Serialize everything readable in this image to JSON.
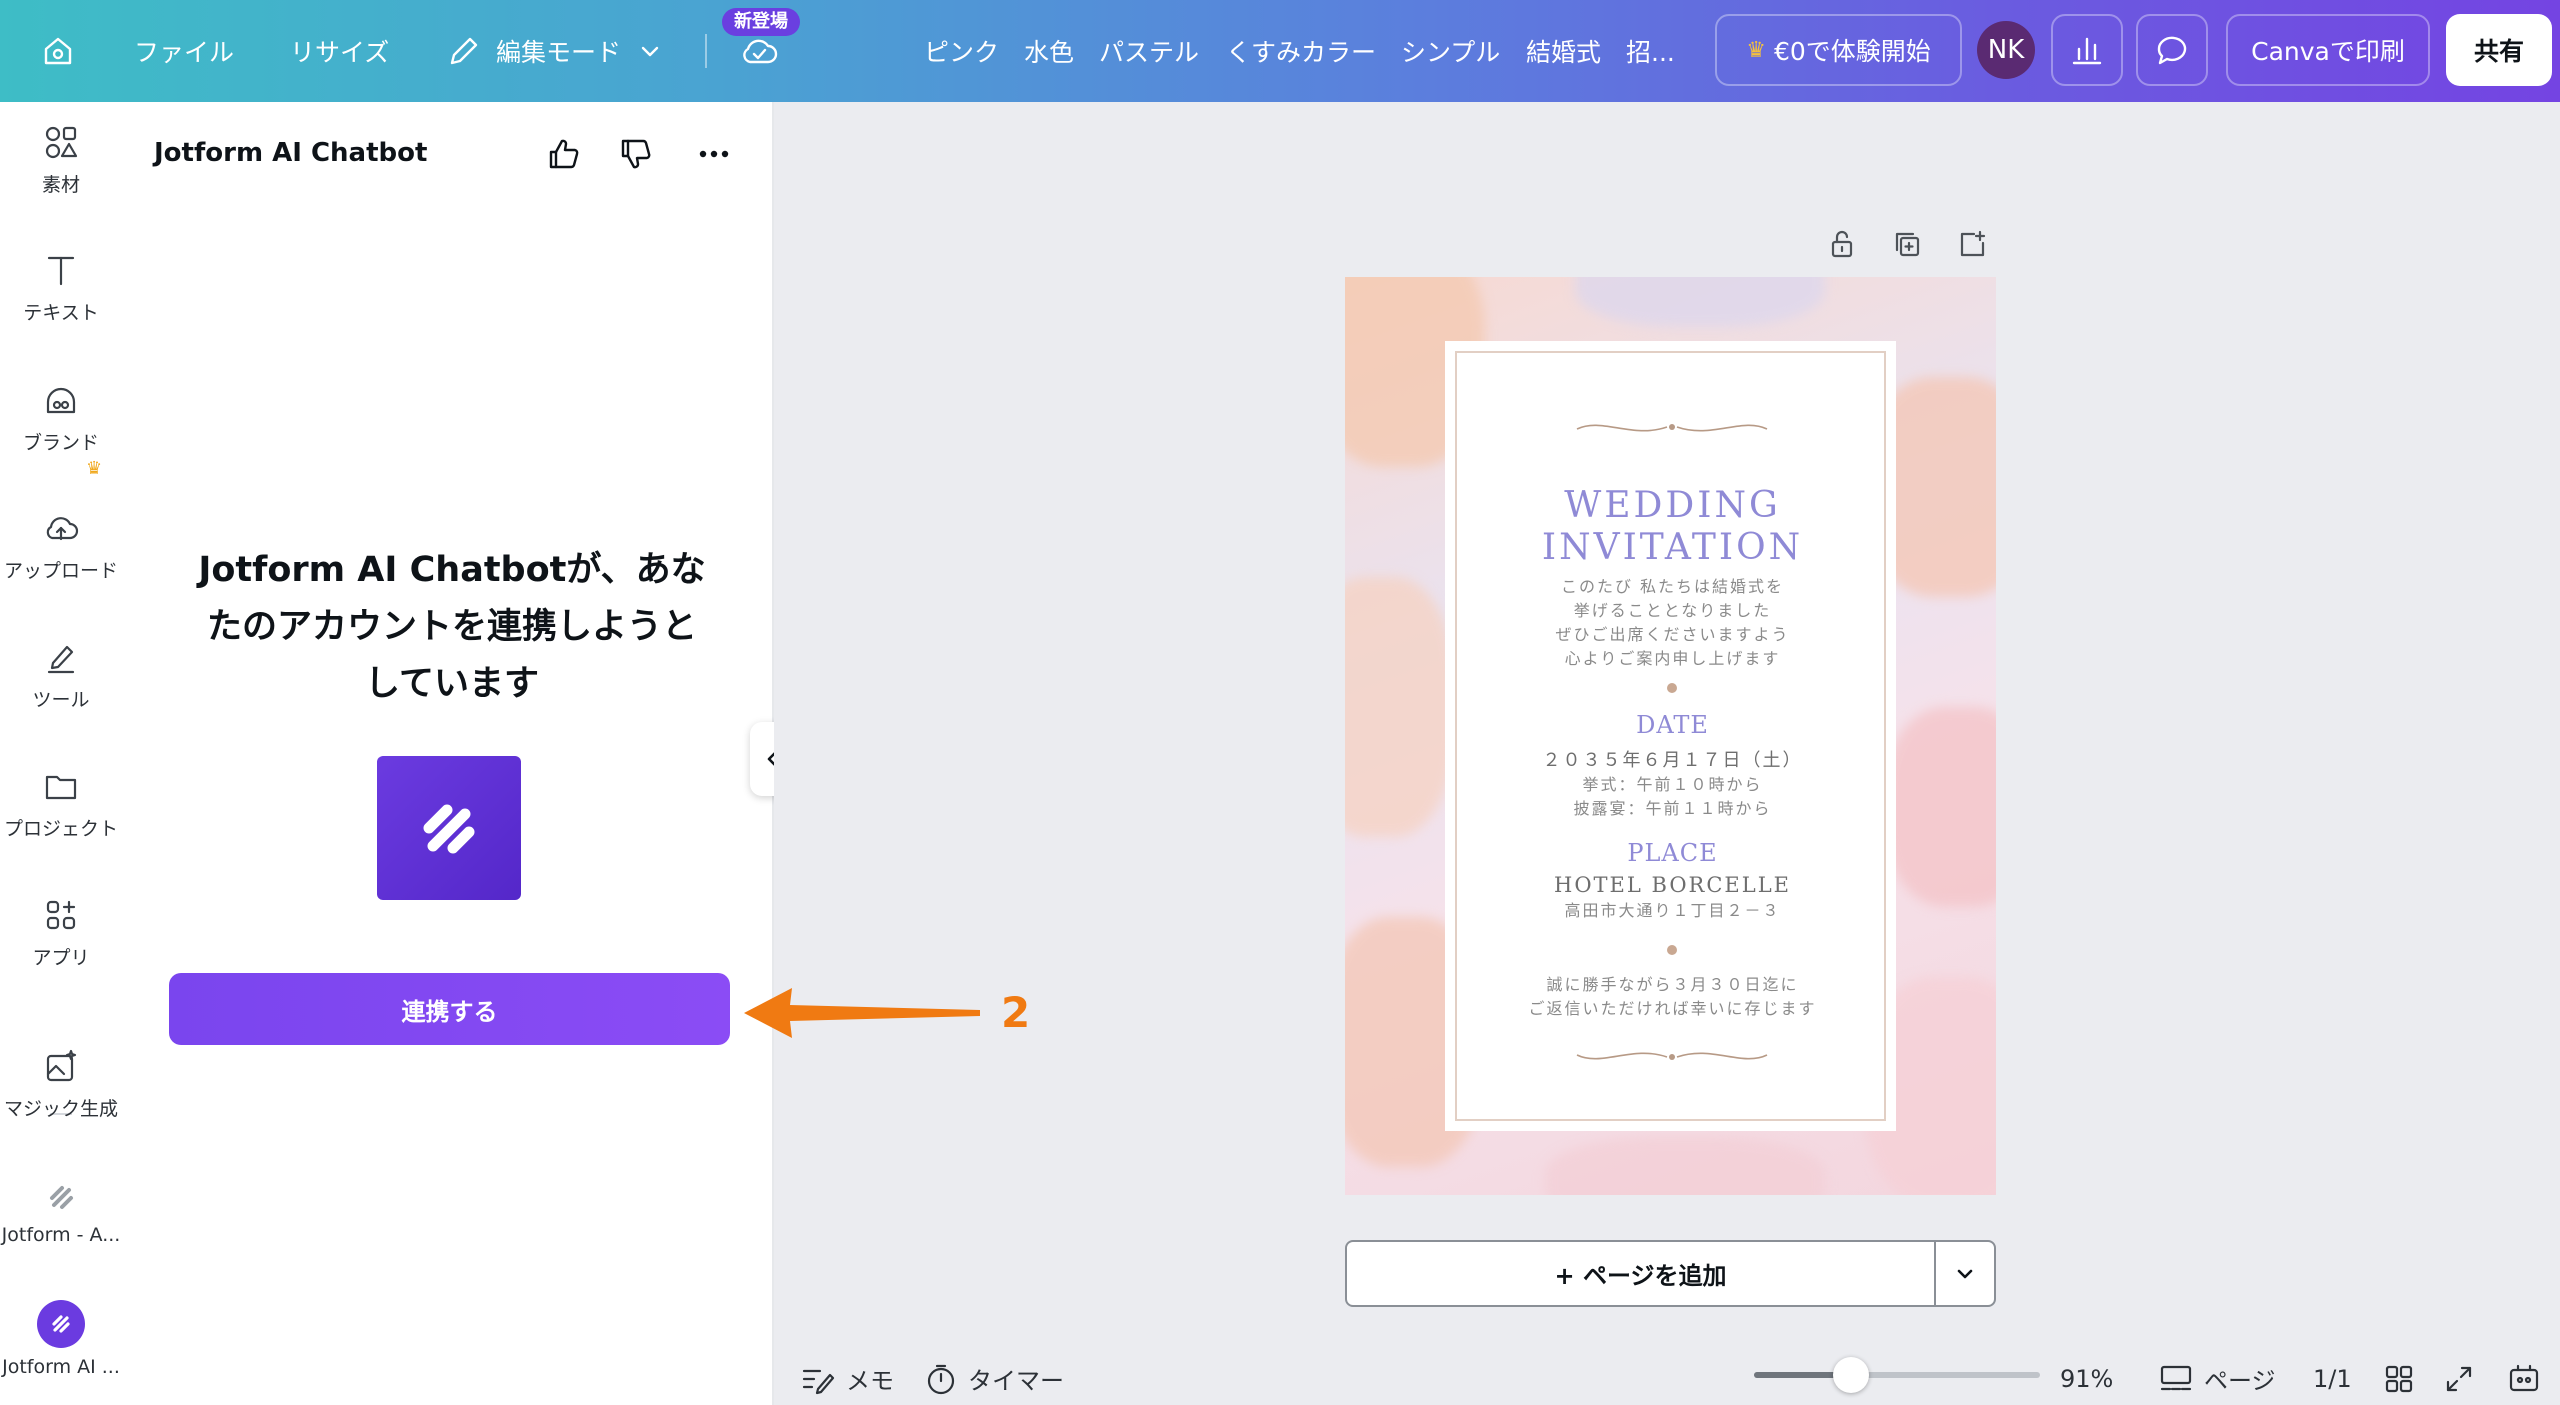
{
  "topbar": {
    "file": "ファイル",
    "resize": "リサイズ",
    "edit_mode": "編集モード",
    "new_badge": "新登場",
    "keywords": [
      "ピンク",
      "水色",
      "パステル",
      "くすみカラー",
      "シンプル",
      "結婚式",
      "招..."
    ],
    "trial": "€0で体験開始",
    "avatar": "NK",
    "print": "Canvaで印刷",
    "share": "共有"
  },
  "rail": {
    "items": [
      "素材",
      "テキスト",
      "ブランド",
      "アップロード",
      "ツール",
      "プロジェクト",
      "アプリ",
      "マジック生成",
      "Jotform - A...",
      "Jotform AI ..."
    ]
  },
  "panel": {
    "title": "Jotform AI Chatbot",
    "message_lines": [
      "Jotform AI Chatbotが、あな",
      "たのアカウントを連携しようと",
      "しています"
    ],
    "connect": "連携する"
  },
  "annotation": {
    "number": "2",
    "color": "#f07a12"
  },
  "design": {
    "title_line1": "WEDDING",
    "title_line2": "INVITATION",
    "intro": [
      "このたび 私たちは結婚式を",
      "挙げることとなりました",
      "ぜひご出席くださいますよう",
      "心よりご案内申し上げます"
    ],
    "date_head": "DATE",
    "date_lines": [
      "２０３５年６月１７日（土）",
      "挙式：午前１０時から",
      "披露宴：午前１１時から"
    ],
    "place_head": "PLACE",
    "place_name": "HOTEL BORCELLE",
    "place_addr": "高田市大通り１丁目２－３",
    "rsvp": [
      "誠に勝手ながら３月３０日迄に",
      "ご返信いただければ幸いに存じます"
    ]
  },
  "add_page": "+ ページを追加",
  "bottom": {
    "memo": "メモ",
    "timer": "タイマー",
    "zoom": "91%",
    "zoom_fraction": 0.34,
    "pages_label": "ページ",
    "page_count": "1/1"
  },
  "colors": {
    "accent": "#7a45ee",
    "topbar_start": "#3ebdc6",
    "topbar_end": "#7444e2"
  }
}
